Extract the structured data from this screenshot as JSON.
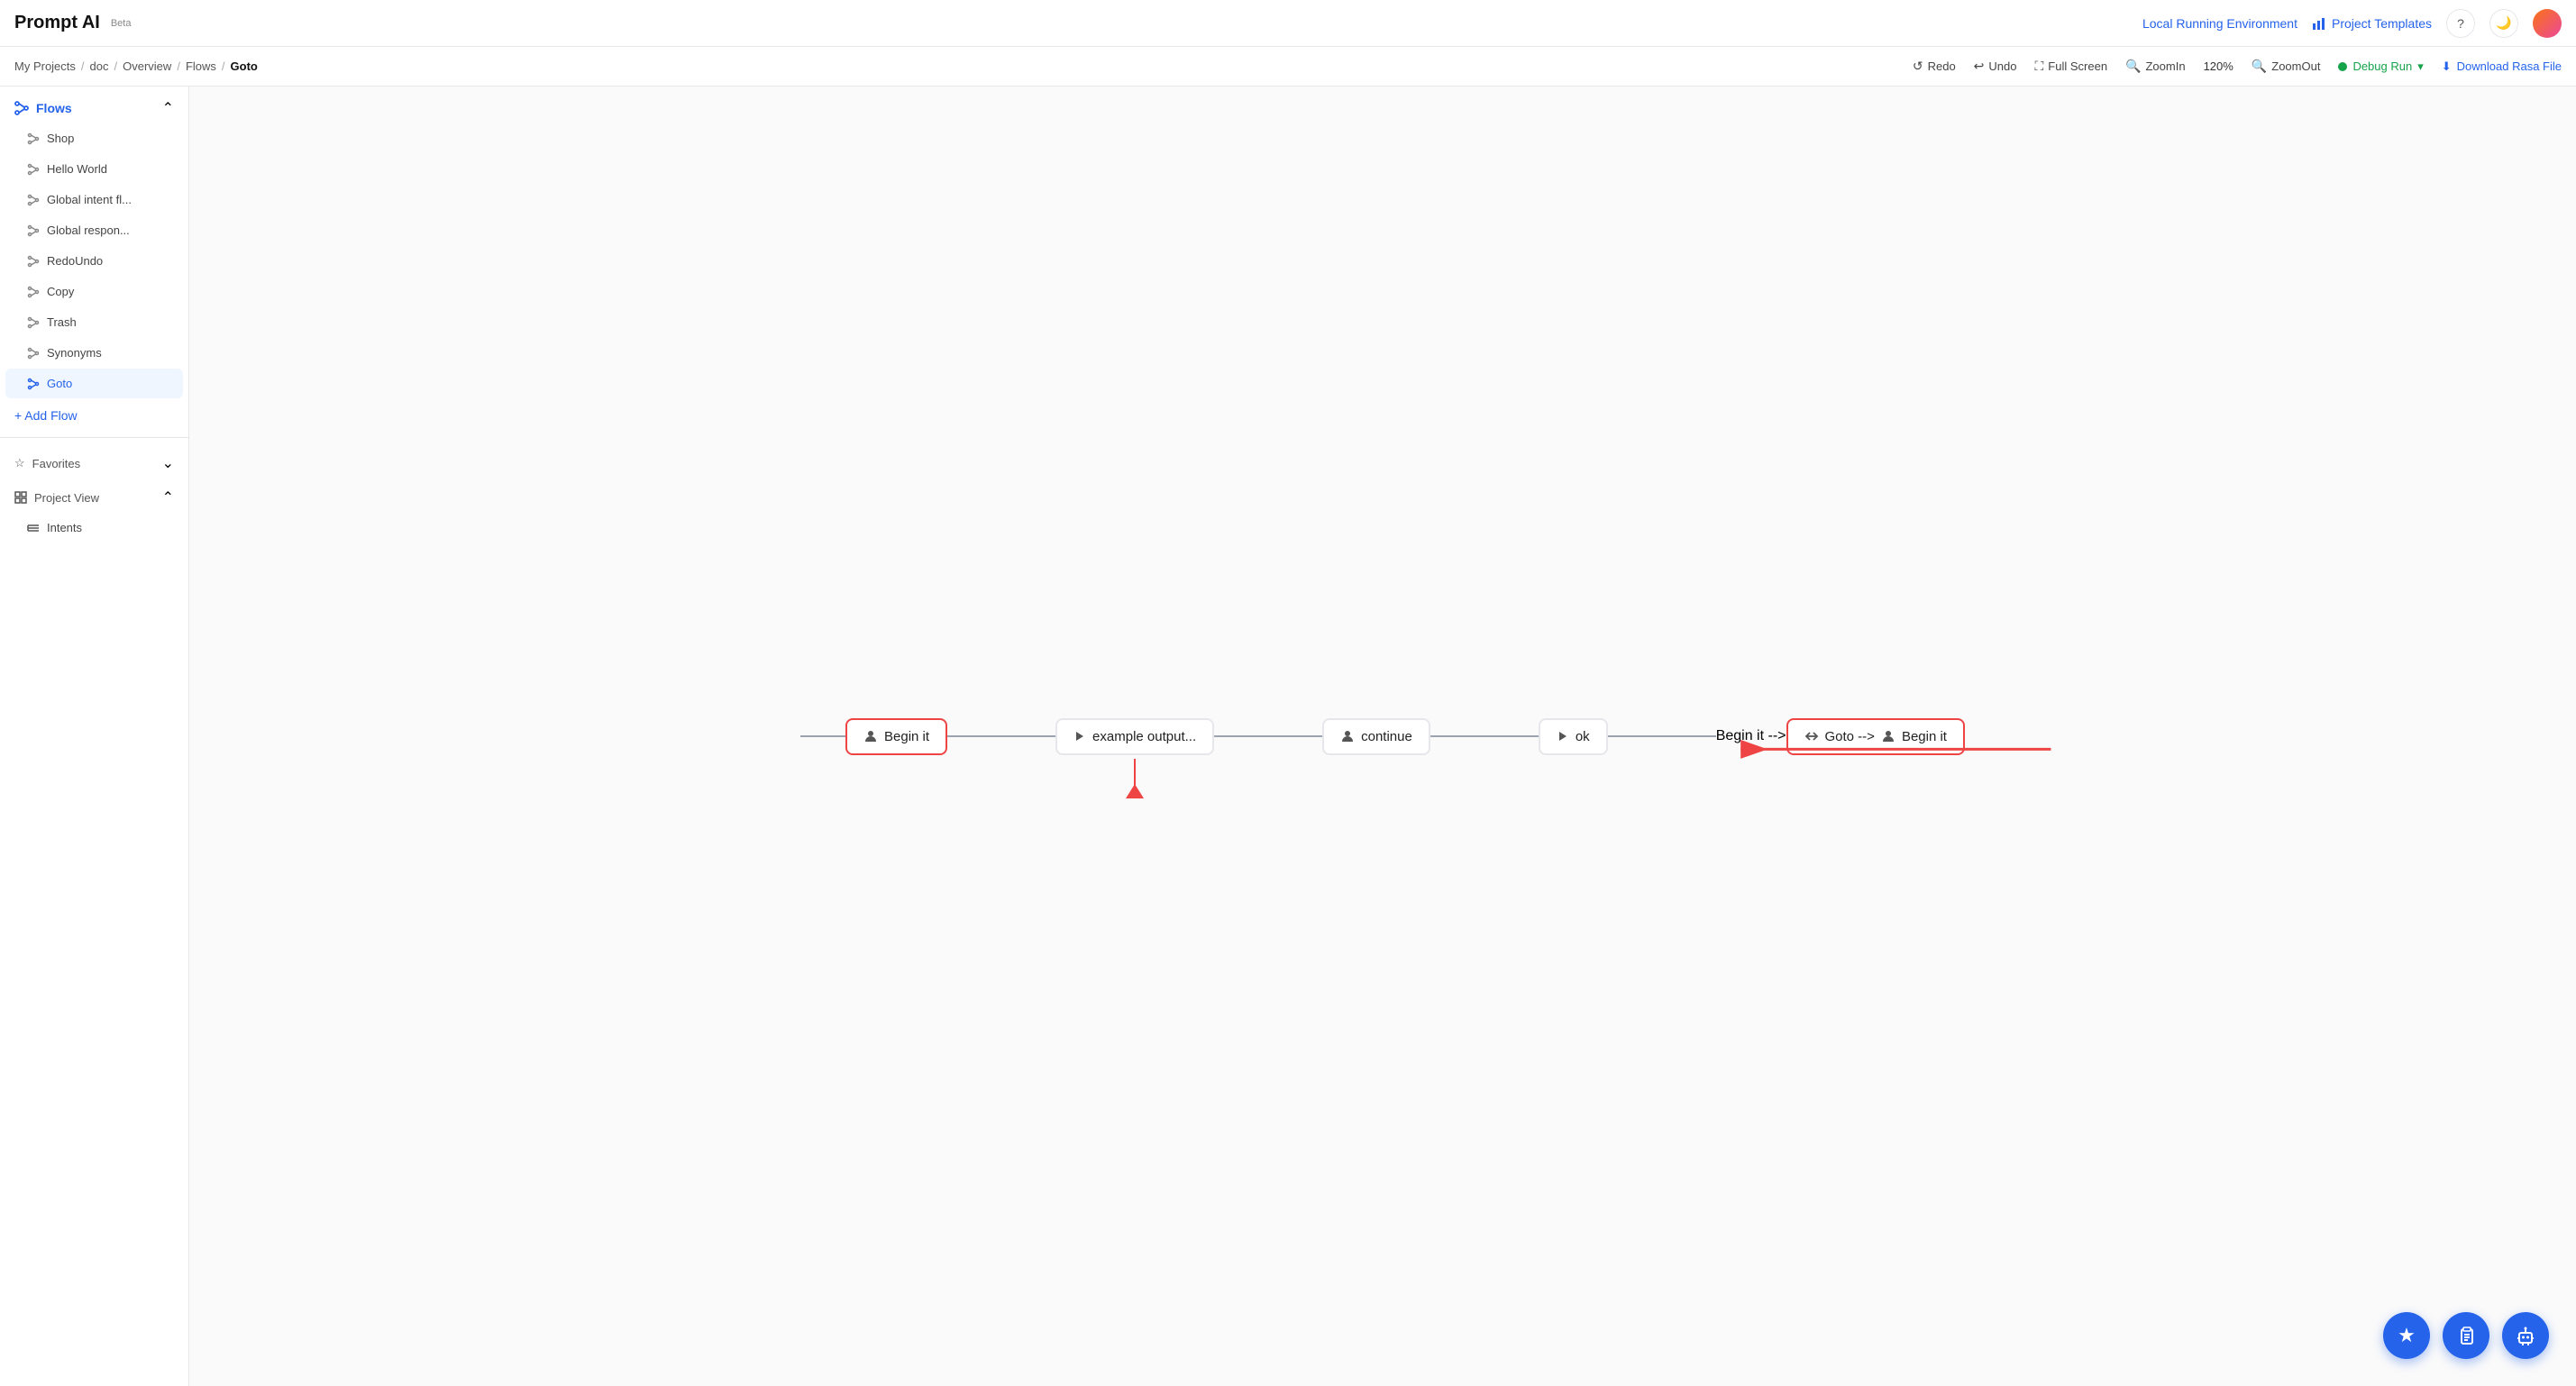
{
  "app": {
    "title": "Prompt AI",
    "beta_label": "Beta"
  },
  "top_nav": {
    "local_env_label": "Local Running Environment",
    "project_templates_label": "Project Templates",
    "help_icon": "?",
    "dark_mode_icon": "🌙"
  },
  "breadcrumb": {
    "items": [
      {
        "label": "My Projects",
        "active": false
      },
      {
        "label": "doc",
        "active": false
      },
      {
        "label": "Overview",
        "active": false
      },
      {
        "label": "Flows",
        "active": false
      },
      {
        "label": "Goto",
        "active": true
      }
    ]
  },
  "toolbar": {
    "redo_label": "Redo",
    "undo_label": "Undo",
    "fullscreen_label": "Full Screen",
    "zoomin_label": "ZoomIn",
    "zoom_level": "120%",
    "zoomout_label": "ZoomOut",
    "debug_label": "Debug Run",
    "download_label": "Download Rasa File"
  },
  "sidebar": {
    "flows_label": "Flows",
    "flow_items": [
      {
        "id": "shop",
        "label": "Shop"
      },
      {
        "id": "hello-world",
        "label": "Hello World"
      },
      {
        "id": "global-intent",
        "label": "Global intent fl..."
      },
      {
        "id": "global-respon",
        "label": "Global respon..."
      },
      {
        "id": "redo-undo",
        "label": "RedoUndo"
      },
      {
        "id": "copy",
        "label": "Copy"
      },
      {
        "id": "trash",
        "label": "Trash"
      },
      {
        "id": "synonyms",
        "label": "Synonyms"
      },
      {
        "id": "goto",
        "label": "Goto",
        "active": true
      }
    ],
    "add_flow_label": "+ Add Flow",
    "favorites_label": "Favorites",
    "project_view_label": "Project View",
    "intents_label": "Intents"
  },
  "flow": {
    "nodes": [
      {
        "id": "begin-it",
        "label": "Begin it",
        "icon": "person",
        "highlighted": true
      },
      {
        "id": "example-output",
        "label": "example output...",
        "icon": "play"
      },
      {
        "id": "continue",
        "label": "continue",
        "icon": "person"
      },
      {
        "id": "ok",
        "label": "ok",
        "icon": "play"
      },
      {
        "id": "goto-begin",
        "label": "Goto --> Begin it",
        "icon": "goto",
        "highlighted": true
      }
    ]
  },
  "fab_buttons": [
    {
      "id": "star-fab",
      "icon": "★"
    },
    {
      "id": "clipboard-fab",
      "icon": "📋"
    },
    {
      "id": "robot-fab",
      "icon": "🤖"
    }
  ]
}
